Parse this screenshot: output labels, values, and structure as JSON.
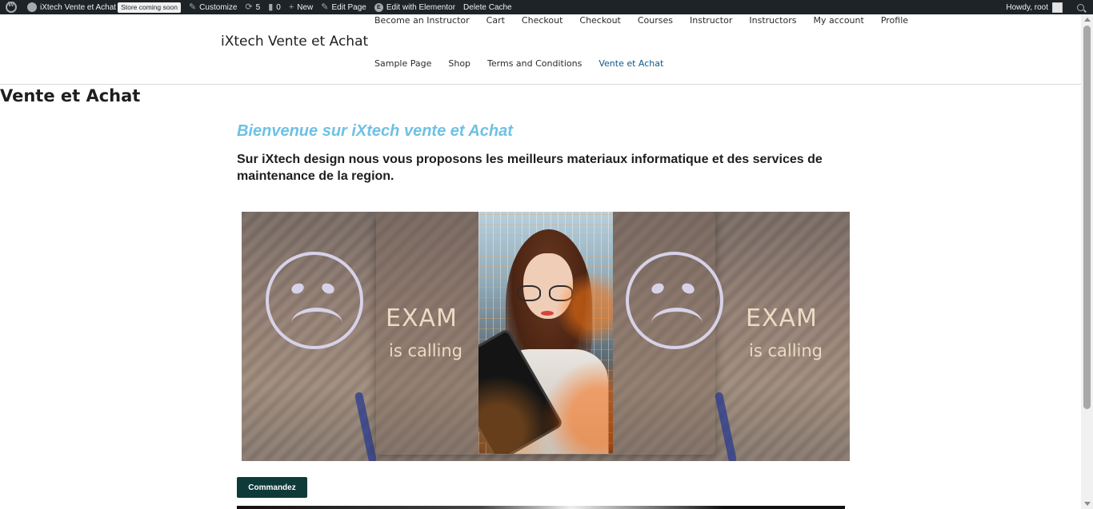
{
  "admin_bar": {
    "site_name": "iXtech Vente et Achat",
    "store_badge": "Store coming soon",
    "customize": "Customize",
    "updates_count": "5",
    "comments_count": "0",
    "new": "New",
    "edit_page": "Edit Page",
    "edit_with_elementor": "Edit with Elementor",
    "delete_cache": "Delete Cache",
    "howdy": "Howdy, root"
  },
  "header": {
    "site_title": "iXtech Vente et Achat",
    "nav_row1": [
      "Become an Instructor",
      "Cart",
      "Checkout",
      "Checkout",
      "Courses",
      "Instructor",
      "Instructors",
      "My account",
      "Profile"
    ],
    "nav_row2": [
      "Sample Page",
      "Shop",
      "Terms and Conditions",
      "Vente et Achat"
    ],
    "current_item": "Vente et Achat"
  },
  "page": {
    "title": "Vente et Achat",
    "welcome": "Bienvenue sur iXtech vente et Achat",
    "intro": "Sur iXtech design nous vous proposons les meilleurs materiaux informatique et des services de maintenance de la region.",
    "order_button": "Commandez"
  },
  "banner": {
    "left_slide": {
      "title": "EXAM",
      "subtitle": "is calling"
    },
    "right_slide": {
      "title": "EXAM",
      "subtitle": "is calling"
    }
  },
  "colors": {
    "admin_bar_bg": "#1d2327",
    "welcome_text": "#6ec1e4",
    "button_bg": "#0f3a3a",
    "current_nav": "#0b5a8a"
  }
}
